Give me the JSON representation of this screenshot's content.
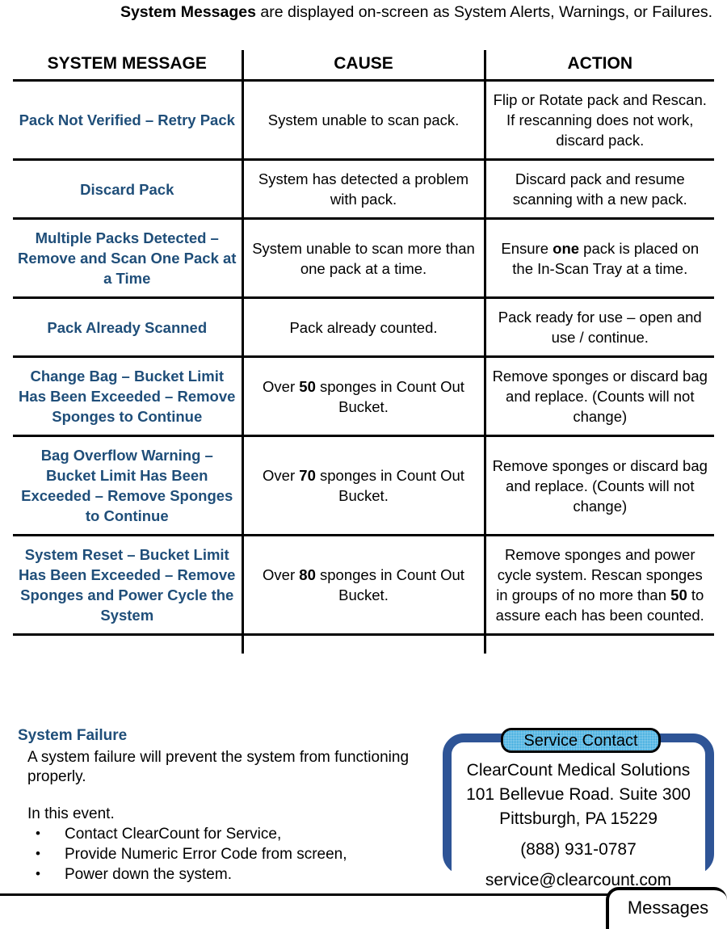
{
  "intro": {
    "lead": "System Messages",
    "rest": " are displayed on-screen as System Alerts, Warnings, or Failures."
  },
  "table": {
    "headers": [
      "SYSTEM MESSAGE",
      "CAUSE",
      "ACTION"
    ],
    "rows": [
      {
        "message": "Pack Not Verified – Retry Pack",
        "cause": "System unable to scan pack.",
        "action": "Flip or Rotate pack and Rescan. If rescanning does not work, discard pack."
      },
      {
        "message": "Discard Pack",
        "cause": "System has detected a problem with pack.",
        "action": "Discard pack and resume scanning with a new pack."
      },
      {
        "message": "Multiple Packs Detected – Remove and Scan One Pack at a Time",
        "cause": "System unable to scan more than one pack at a time.",
        "action_pre": "Ensure ",
        "action_bold": "one",
        "action_post": " pack is placed on the In-Scan Tray at a time."
      },
      {
        "message": "Pack Already Scanned",
        "cause": "Pack already counted.",
        "action": "Pack ready for use – open and use / continue."
      },
      {
        "message": "Change Bag – Bucket Limit Has Been Exceeded – Remove Sponges to Continue",
        "cause_pre": "Over ",
        "cause_bold": "50",
        "cause_post": " sponges in Count Out Bucket.",
        "action": "Remove sponges or discard bag and replace. (Counts will not change)"
      },
      {
        "message": "Bag Overflow Warning – Bucket Limit Has Been Exceeded – Remove Sponges to Continue",
        "cause_pre": "Over ",
        "cause_bold": "70",
        "cause_post": " sponges in Count Out Bucket.",
        "action": "Remove sponges or discard bag and replace. (Counts will not change)"
      },
      {
        "message": "System Reset – Bucket Limit Has Been Exceeded – Remove Sponges and Power Cycle the System",
        "cause_pre": "Over ",
        "cause_bold": "80",
        "cause_post": " sponges in Count Out Bucket.",
        "action_pre": "Remove sponges and power cycle system. Rescan sponges in groups of no more than ",
        "action_bold": "50",
        "action_post": " to assure each has been counted."
      }
    ]
  },
  "failure": {
    "heading": "System Failure",
    "paragraph": "A system failure will prevent the system from functioning properly.",
    "event_intro": "In this event.",
    "bullets": [
      "Contact ClearCount for Service,",
      "Provide Numeric Error Code from screen,",
      "Power down the system."
    ]
  },
  "service_contact": {
    "badge_label": "Service Contact",
    "company": "ClearCount Medical Solutions",
    "street": "101 Bellevue Road. Suite 300",
    "city_state_zip": "Pittsburgh, PA 15229",
    "phone": "(888) 931-0787",
    "email": "service@clearcount.com"
  },
  "footer": {
    "tab_label": "Messages"
  },
  "colors": {
    "heading_blue": "#1F4E79",
    "box_border_blue": "#2E5496",
    "badge_cyan": "#29A3DC",
    "text_black": "#000000"
  }
}
